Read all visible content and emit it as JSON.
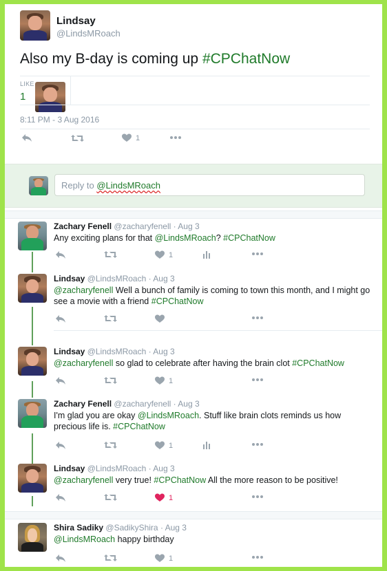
{
  "main_tweet": {
    "name": "Lindsay",
    "handle": "@LindsMRoach",
    "text_plain": "Also my B-day is coming up ",
    "hashtag": "#CPChatNow",
    "likes_label": "LIKE",
    "likes_count": "1",
    "timestamp": "8:11 PM - 3 Aug 2016",
    "like_action_count": "1"
  },
  "reply_box": {
    "prefix": "Reply to ",
    "mention": "@LindsMRoach"
  },
  "replies": [
    {
      "name": "Zachary Fenell",
      "handle": "@zacharyfenell",
      "sep": " · ",
      "date": "Aug 3",
      "parts": [
        {
          "t": "Any exciting plans for that ",
          "k": "text"
        },
        {
          "t": "@LindsMRoach",
          "k": "mention"
        },
        {
          "t": "? ",
          "k": "text"
        },
        {
          "t": "#CPChatNow",
          "k": "hashtag"
        }
      ],
      "like_count": "1",
      "liked": false,
      "analytics": true
    },
    {
      "name": "Lindsay",
      "handle": "@LindsMRoach",
      "sep": " · ",
      "date": "Aug 3",
      "parts": [
        {
          "t": "@zacharyfenell",
          "k": "mention"
        },
        {
          "t": " Well a bunch of family is coming to town this month, and I might go see a movie with a friend ",
          "k": "text"
        },
        {
          "t": "#CPChatNow",
          "k": "hashtag"
        }
      ],
      "like_count": "",
      "liked": false,
      "analytics": false
    },
    {
      "name": "Lindsay",
      "handle": "@LindsMRoach",
      "sep": " · ",
      "date": "Aug 3",
      "parts": [
        {
          "t": "@zacharyfenell",
          "k": "mention"
        },
        {
          "t": " so glad to celebrate after having the brain clot ",
          "k": "text"
        },
        {
          "t": "#CPChatNow",
          "k": "hashtag"
        }
      ],
      "like_count": "1",
      "liked": false,
      "analytics": false
    },
    {
      "name": "Zachary Fenell",
      "handle": "@zacharyfenell",
      "sep": " · ",
      "date": "Aug 3",
      "parts": [
        {
          "t": "I'm glad you are okay ",
          "k": "text"
        },
        {
          "t": "@LindsMRoach",
          "k": "mention"
        },
        {
          "t": ". Stuff like brain clots reminds us how precious life is. ",
          "k": "text"
        },
        {
          "t": "#CPChatNow",
          "k": "hashtag"
        }
      ],
      "like_count": "1",
      "liked": false,
      "analytics": true
    },
    {
      "name": "Lindsay",
      "handle": "@LindsMRoach",
      "sep": " · ",
      "date": "Aug 3",
      "parts": [
        {
          "t": "@zacharyfenell",
          "k": "mention"
        },
        {
          "t": " very true! ",
          "k": "text"
        },
        {
          "t": "#CPChatNow",
          "k": "hashtag"
        },
        {
          "t": " All the more reason to be positive!",
          "k": "text"
        }
      ],
      "like_count": "1",
      "liked": true,
      "analytics": false
    },
    {
      "name": "Shira Sadiky",
      "handle": "@SadikyShira",
      "sep": " · ",
      "date": "Aug 3",
      "parts": [
        {
          "t": "@LindsMRoach",
          "k": "mention"
        },
        {
          "t": " happy birthday",
          "k": "text"
        }
      ],
      "like_count": "1",
      "liked": false,
      "analytics": false
    }
  ],
  "icons": {
    "reply": "reply-icon",
    "retweet": "retweet-icon",
    "like": "heart-icon",
    "analytics": "analytics-icon",
    "more": "more-icon"
  },
  "colors": {
    "frame_border": "#9fe34a",
    "accent_green": "#1f7a2a",
    "liked_red": "#e0245e",
    "thread_line": "#5fa05a"
  }
}
